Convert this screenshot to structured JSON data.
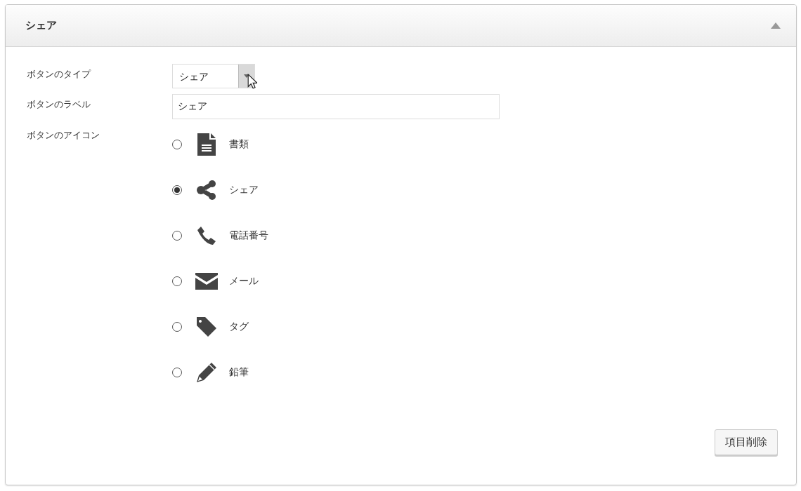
{
  "panel": {
    "title": "シェア",
    "expanded": true
  },
  "fields": [
    {
      "kind": "select",
      "label": "ボタンのタイプ",
      "value": "シェア"
    },
    {
      "kind": "text",
      "label": "ボタンのラベル",
      "value": "シェア"
    },
    {
      "kind": "icons",
      "label": "ボタンのアイコン"
    }
  ],
  "icon_options": [
    {
      "kind": "document",
      "label": "書類",
      "selected": false
    },
    {
      "kind": "share",
      "label": "シェア",
      "selected": true
    },
    {
      "kind": "phone",
      "label": "電話番号",
      "selected": false
    },
    {
      "kind": "mail",
      "label": "メール",
      "selected": false
    },
    {
      "kind": "tag",
      "label": "タグ",
      "selected": false
    },
    {
      "kind": "pencil",
      "label": "鉛筆",
      "selected": false
    }
  ],
  "delete_button": "項目削除"
}
